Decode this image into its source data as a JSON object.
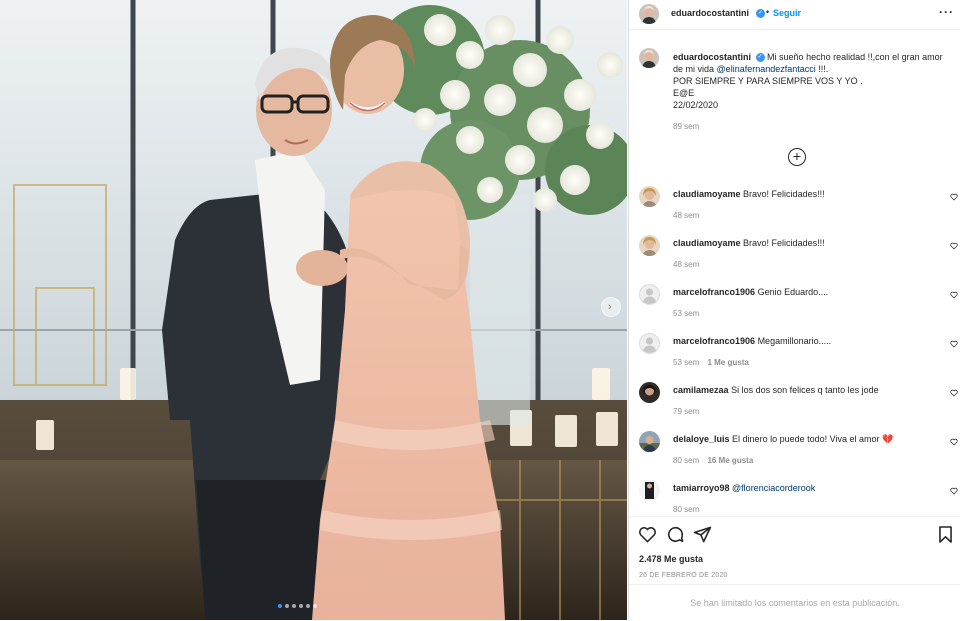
{
  "post": {
    "username": "eduardocostantini",
    "follow_label": "Seguir",
    "caption_lines": [
      "Mi sueño hecho realidad !!,con el gran amor",
      "de mi vida",
      "POR SIEMPRE Y PARA SIEMPRE VOS Y YO .",
      "E@E",
      "22/02/2020"
    ],
    "caption_mention": "@elinafernandezfantacci",
    "caption_mention_tail": "!!!.",
    "caption_age": "89 sem",
    "likes": "2.478 Me gusta",
    "date": "26 DE FEBRERO DE 2020",
    "comments_limited": "Se han limitado los comentarios en esta publicación.",
    "carousel_dots": 6,
    "carousel_active": 0
  },
  "comments": [
    {
      "user": "claudiamoyame",
      "text": "Bravo! Felicidades!!!",
      "age": "48 sem",
      "likes": "",
      "avatar": "photo-blonde"
    },
    {
      "user": "claudiamoyame",
      "text": "Bravo! Felicidades!!!",
      "age": "48 sem",
      "likes": "",
      "avatar": "photo-blonde"
    },
    {
      "user": "marcelofranco1906",
      "text": "Genio Eduardo....",
      "age": "53 sem",
      "likes": "",
      "avatar": "default"
    },
    {
      "user": "marcelofranco1906",
      "text": "Megamillonario.....",
      "age": "53 sem",
      "likes": "1 Me gusta",
      "avatar": "default"
    },
    {
      "user": "camilamezaa",
      "text": "Si los dos son felices q tanto les jode",
      "age": "79 sem",
      "likes": "",
      "avatar": "photo-dark"
    },
    {
      "user": "delaloye_luis",
      "text": "El dinero lo puede todo! Viva el amor 💔",
      "age": "80 sem",
      "likes": "16 Me gusta",
      "avatar": "photo-outdoor"
    },
    {
      "user": "tamiarroyo98",
      "text": "",
      "mention": "@florenciacorderook",
      "age": "80 sem",
      "likes": "",
      "avatar": "photo-portrait"
    }
  ],
  "icons": {
    "more": "more-options-icon",
    "add": "load-more-comments-icon",
    "like": "heart-icon",
    "comment": "comment-icon",
    "share": "share-icon",
    "save": "bookmark-icon",
    "next": "chevron-right-icon"
  },
  "colors": {
    "link": "#00376b",
    "verified": "#3897f0",
    "muted": "#8e8e8e",
    "heart_emoji": "#d6394a"
  }
}
